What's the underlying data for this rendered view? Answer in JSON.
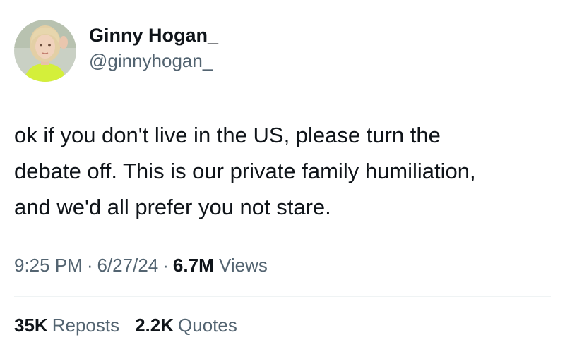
{
  "user": {
    "display_name": "Ginny Hogan_",
    "handle": "@ginnyhogan_",
    "avatar_icon": "profile-photo"
  },
  "tweet": {
    "lines": [
      "ok if you don't live in the US, please turn the",
      "debate off. This is our private family humiliation,",
      "and we'd all prefer you not stare."
    ]
  },
  "meta": {
    "time": "9:25 PM",
    "separator": "·",
    "date": "6/27/24",
    "views_count": "6.7M",
    "views_label": "Views"
  },
  "stats": {
    "reposts_count": "35K",
    "reposts_label": "Reposts",
    "quotes_count": "2.2K",
    "quotes_label": "Quotes"
  },
  "colors": {
    "text_primary": "#0f1419",
    "text_secondary": "#536471",
    "divider": "#eff3f4",
    "avatar_accent": "#d4ef3a"
  }
}
